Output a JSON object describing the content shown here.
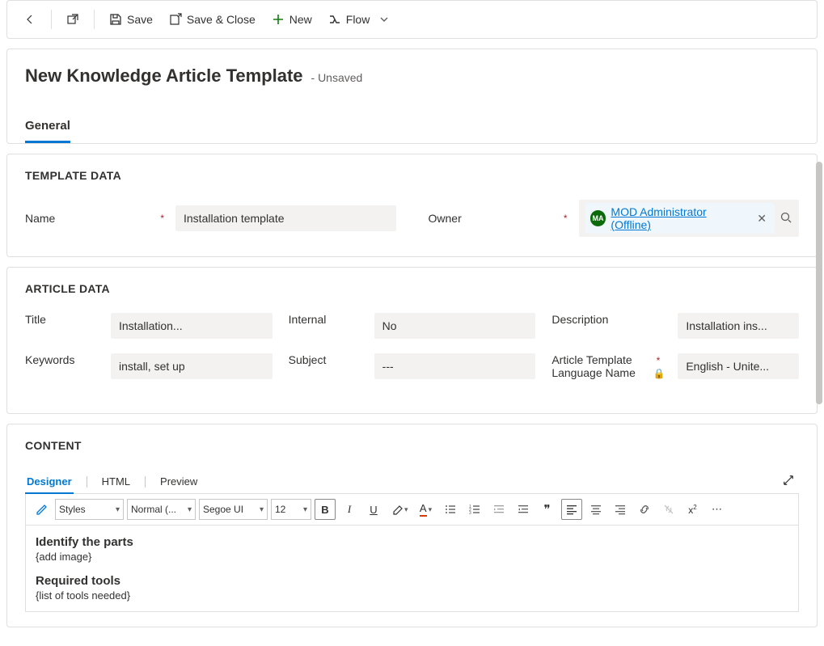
{
  "toolbar": {
    "save_label": "Save",
    "save_close_label": "Save & Close",
    "new_label": "New",
    "flow_label": "Flow"
  },
  "header": {
    "title": "New Knowledge Article Template",
    "status": "- Unsaved",
    "tabs": [
      "General"
    ]
  },
  "template_data": {
    "section_title": "TEMPLATE DATA",
    "name_label": "Name",
    "name_value": "Installation template",
    "owner_label": "Owner",
    "owner_value": "MOD Administrator (Offline)",
    "owner_initials": "MA"
  },
  "article_data": {
    "section_title": "ARTICLE DATA",
    "title_label": "Title",
    "title_value": "Installation...",
    "internal_label": "Internal",
    "internal_value": "No",
    "description_label": "Description",
    "description_value": "Installation ins...",
    "keywords_label": "Keywords",
    "keywords_value": "install, set up",
    "subject_label": "Subject",
    "subject_value": "---",
    "lang_label": "Article Template Language Name",
    "lang_value": "English - Unite..."
  },
  "content": {
    "section_title": "CONTENT",
    "editor_tabs": [
      "Designer",
      "HTML",
      "Preview"
    ],
    "styles_label": "Styles",
    "format_label": "Normal (...",
    "font_label": "Segoe UI",
    "size_label": "12",
    "body": {
      "h1": "Identify the parts",
      "p1": "{add image}",
      "h2": "Required tools",
      "p2": "{list of tools needed}"
    }
  }
}
